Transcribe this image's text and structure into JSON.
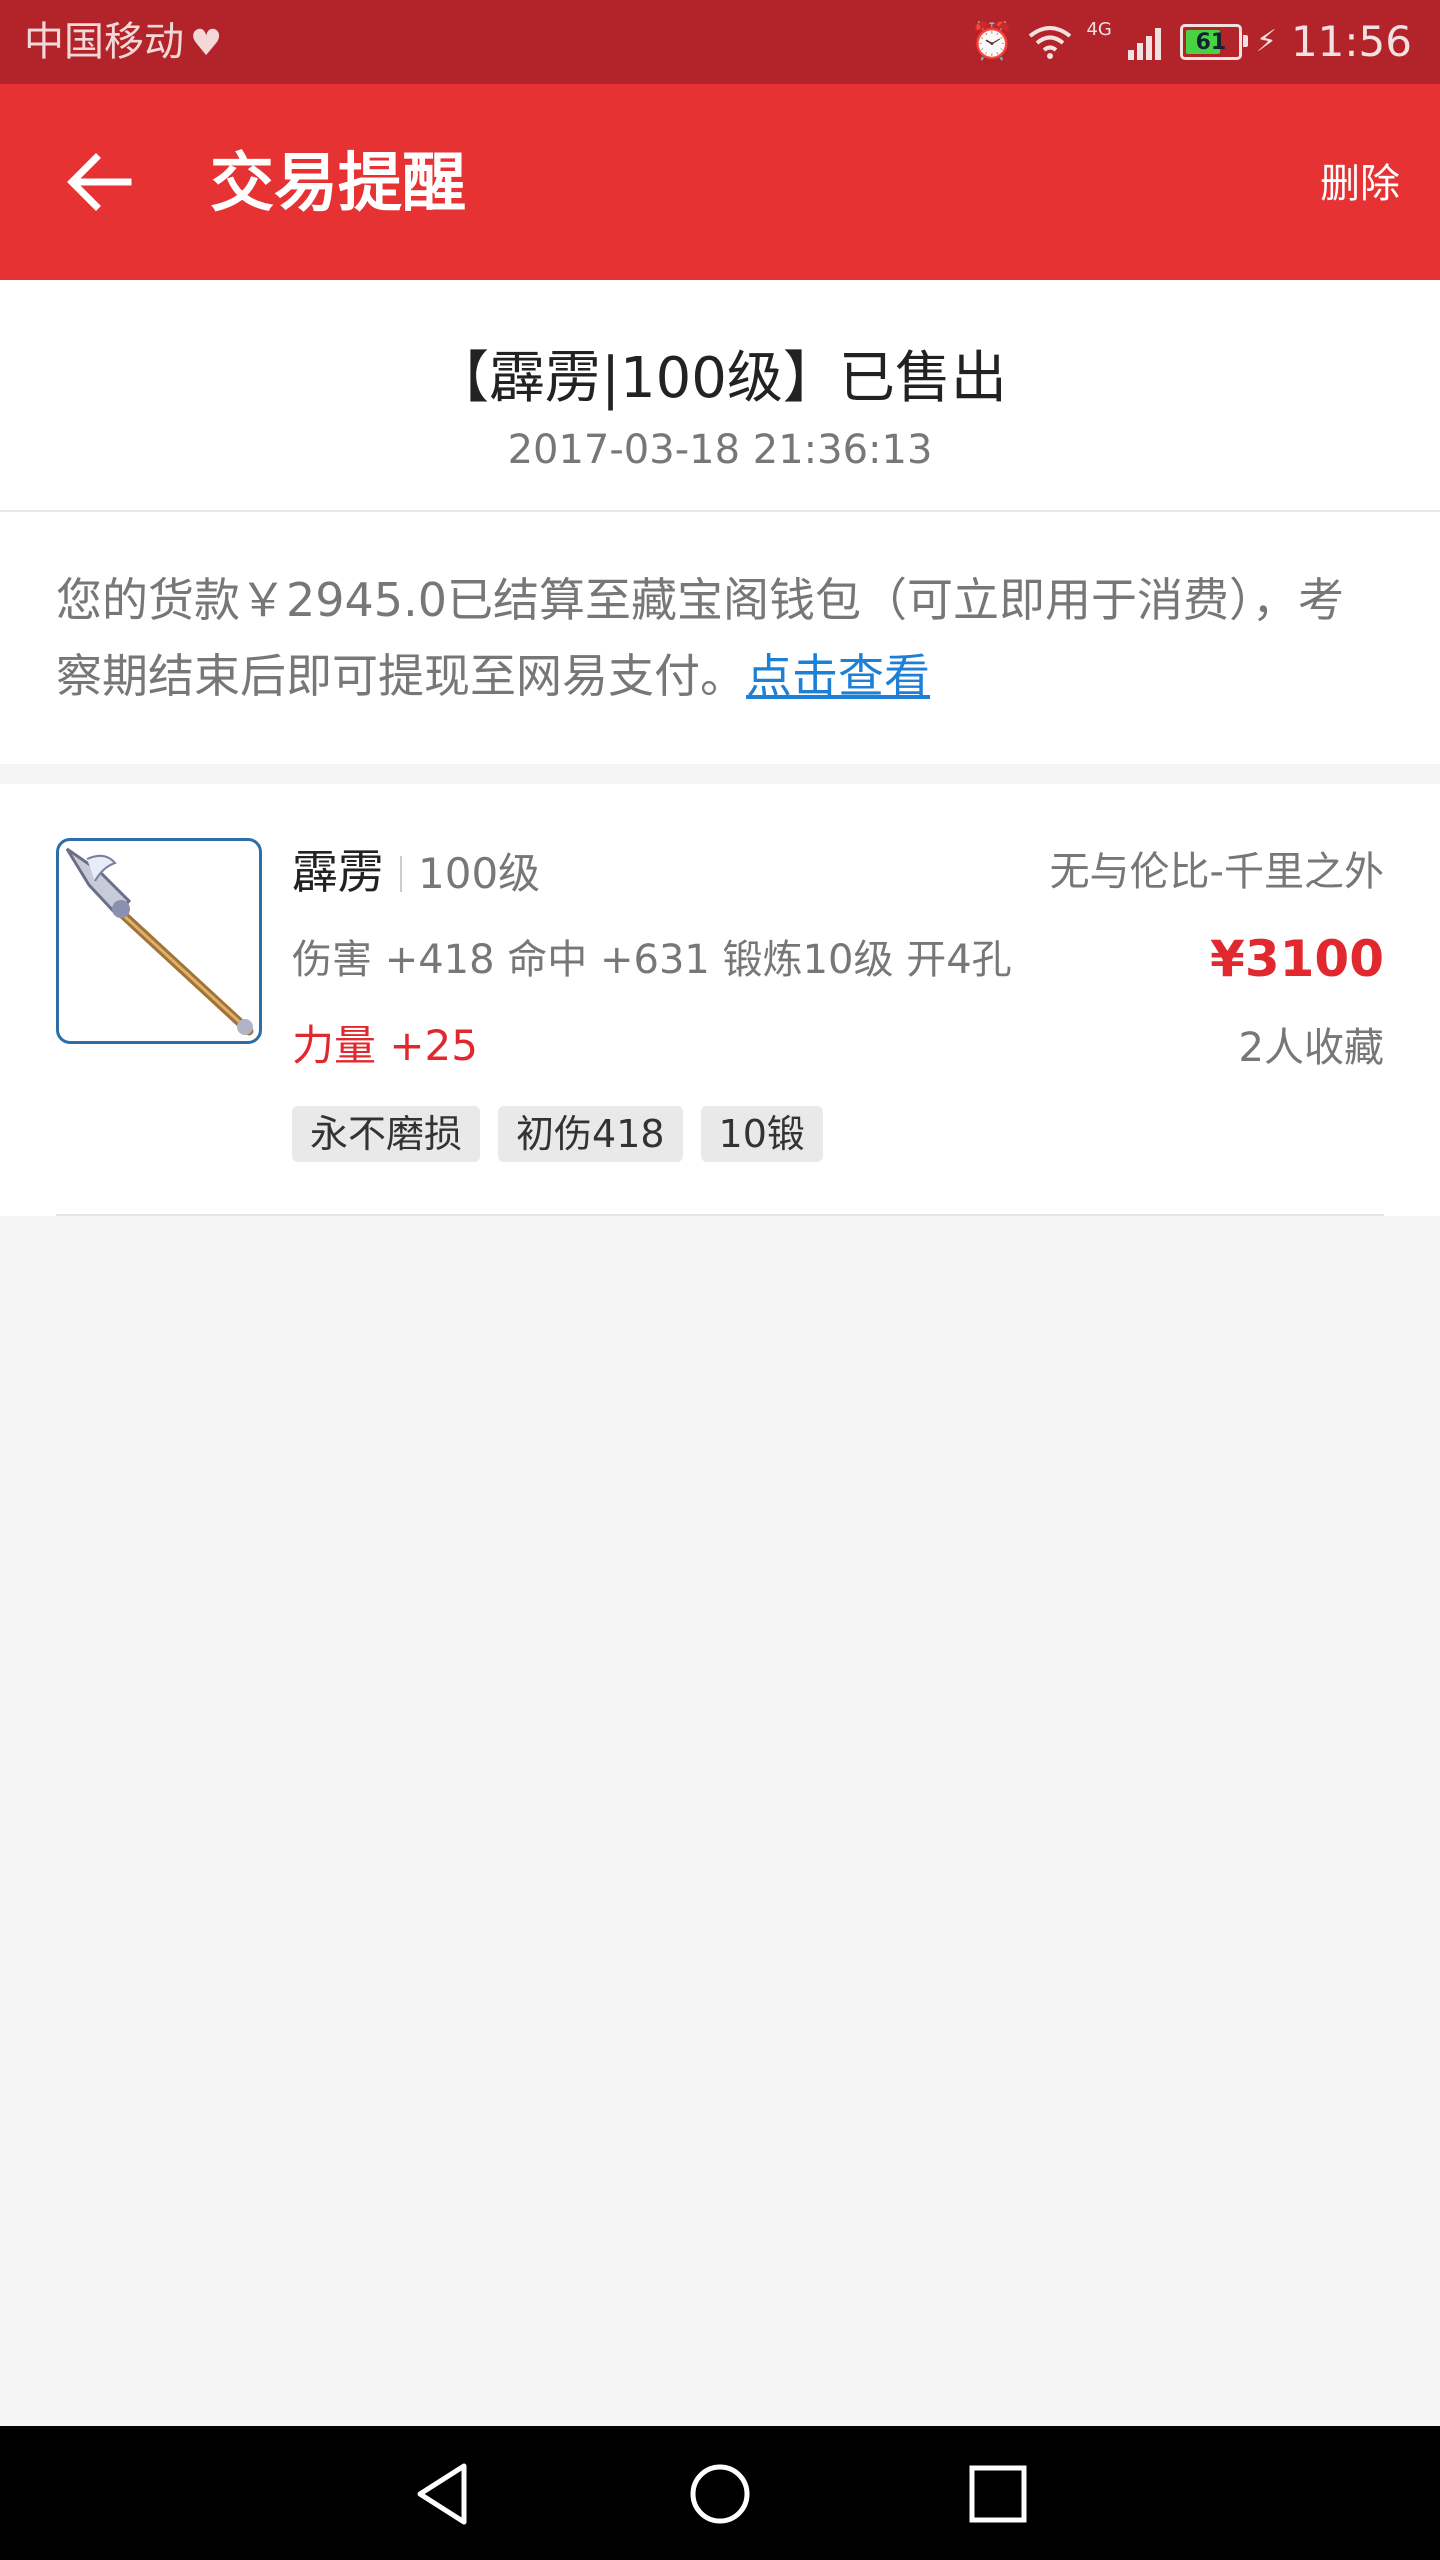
{
  "status_bar": {
    "carrier": "中国移动",
    "network": "4G",
    "battery": "61",
    "time": "11:56"
  },
  "app_bar": {
    "title": "交易提醒",
    "delete_label": "删除"
  },
  "notice": {
    "title": "【霹雳|100级】已售出",
    "timestamp": "2017-03-18 21:36:13",
    "message": "您的货款￥2945.0已结算至藏宝阁钱包（可立即用于消费），考察期结束后即可提现至网易支付。",
    "link_text": "点击查看"
  },
  "item": {
    "name": "霹雳",
    "level": "100级",
    "server": "无与伦比-千里之外",
    "stats": "伤害 +418 命中 +631 锻炼10级 开4孔",
    "price": "¥3100",
    "attribute": "力量 +25",
    "favorites": "2人收藏",
    "tags": [
      "永不磨损",
      "初伤418",
      "10锻"
    ]
  },
  "colors": {
    "status_bar": "#b3242a",
    "app_bar": "#e63233",
    "price_red": "#e0282e",
    "link_blue": "#1e7fd6"
  }
}
